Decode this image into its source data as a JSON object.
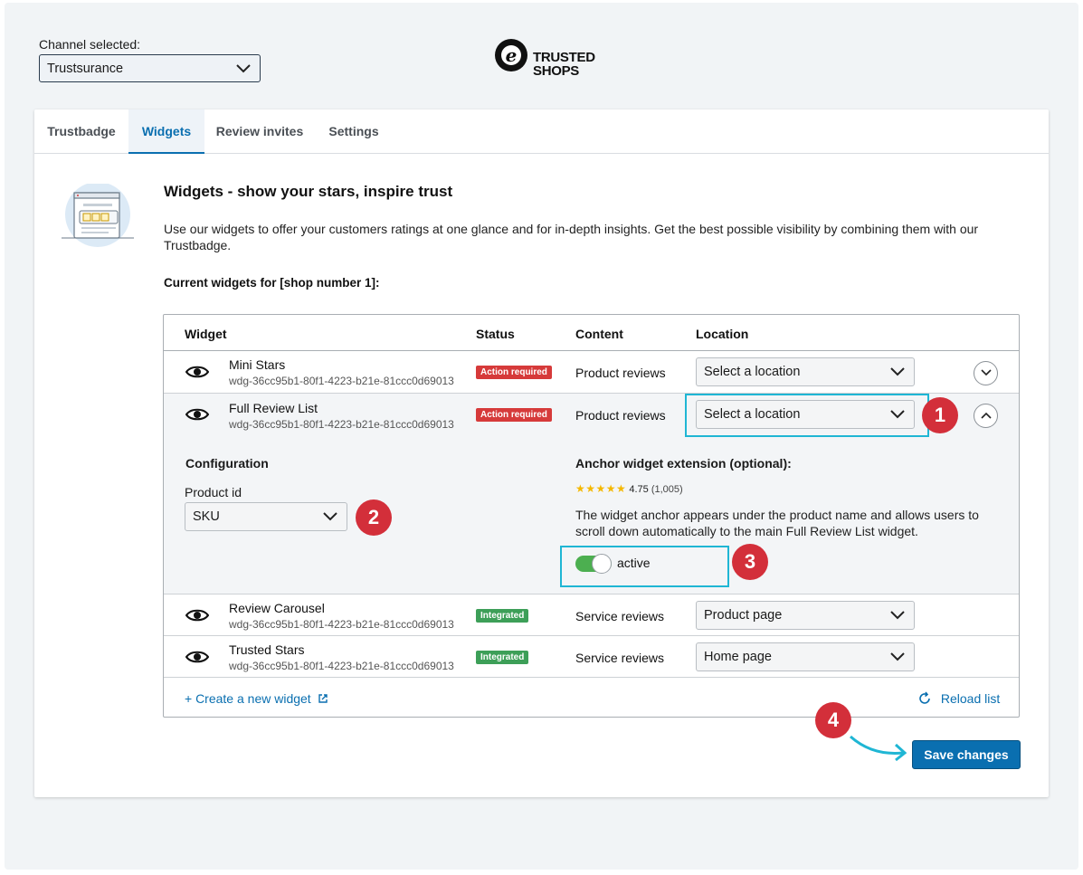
{
  "channel": {
    "label": "Channel selected:",
    "value": "Trustsurance"
  },
  "logo": {
    "line1": "TRUSTED",
    "line2": "SHOPS",
    "mark": "e"
  },
  "tabs": [
    {
      "label": "Trustbadge"
    },
    {
      "label": "Widgets"
    },
    {
      "label": "Review invites"
    },
    {
      "label": "Settings"
    }
  ],
  "active_tab": "Widgets",
  "page": {
    "title": "Widgets - show your stars, inspire trust",
    "description": "Use our widgets to offer your customers ratings at one glance and for in-depth insights. Get the best possible visibility by combining them with our Trustbadge.",
    "current_label": "Current widgets for [shop number 1]:"
  },
  "table": {
    "headers": {
      "widget": "Widget",
      "status": "Status",
      "content": "Content",
      "location": "Location"
    },
    "rows": [
      {
        "name": "Mini Stars",
        "id": "wdg-36cc95b1-80f1-4223-b21e-81ccc0d69013",
        "status": "Action required",
        "content": "Product reviews",
        "location": "Select a location"
      },
      {
        "name": "Full Review List",
        "id": "wdg-36cc95b1-80f1-4223-b21e-81ccc0d69013",
        "status": "Action required",
        "content": "Product reviews",
        "location": "Select a location"
      },
      {
        "name": "Review Carousel",
        "id": "wdg-36cc95b1-80f1-4223-b21e-81ccc0d69013",
        "status": "Integrated",
        "content": "Service reviews",
        "location": "Product page"
      },
      {
        "name": "Trusted Stars",
        "id": "wdg-36cc95b1-80f1-4223-b21e-81ccc0d69013",
        "status": "Integrated",
        "content": "Service reviews",
        "location": "Home page"
      }
    ],
    "config": {
      "title": "Configuration",
      "product_id_label": "Product id",
      "product_id_value": "SKU",
      "anchor_title": "Anchor widget extension (optional):",
      "stars": "★★★★★",
      "rating_value": "4.75",
      "rating_count": "(1,005)",
      "anchor_description": "The widget anchor appears under the product name and allows users to scroll down automatically to the main Full Review List widget.",
      "toggle_label": "active",
      "toggle_on": true
    },
    "create_link": "+ Create a new widget",
    "reload_link": "Reload list"
  },
  "save_button": "Save changes",
  "markers": [
    "1",
    "2",
    "3",
    "4"
  ],
  "colors": {
    "accent": "#0a6fb0",
    "action_required": "#d63a3a",
    "integrated": "#3d9f58",
    "highlight": "#1fb6d4",
    "marker": "#d32f3a"
  }
}
